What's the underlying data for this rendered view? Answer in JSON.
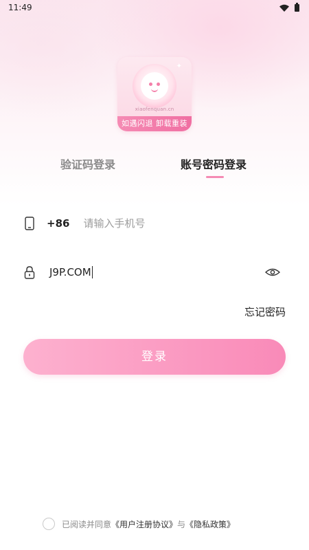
{
  "status_bar": {
    "time": "11:49",
    "icons": [
      "wifi-icon",
      "battery-icon"
    ]
  },
  "logo": {
    "url_text": "xiaofenquan.cn",
    "banner": "如遇闪退 卸载重装"
  },
  "tabs": [
    {
      "label": "验证码登录",
      "active": false
    },
    {
      "label": "账号密码登录",
      "active": true
    }
  ],
  "phone_field": {
    "prefix": "+86",
    "placeholder": "请输入手机号",
    "value": ""
  },
  "password_field": {
    "value": "J9P.COM"
  },
  "forgot_label": "忘记密码",
  "login_label": "登录",
  "agreement": {
    "prefix": "已阅读并同意",
    "terms": "《用户注册协议》",
    "joiner": "与",
    "privacy": "《隐私政策》"
  },
  "colors": {
    "accent": "#f58bb4",
    "button_start": "#fdb1cf",
    "button_end": "#f98ab8"
  }
}
